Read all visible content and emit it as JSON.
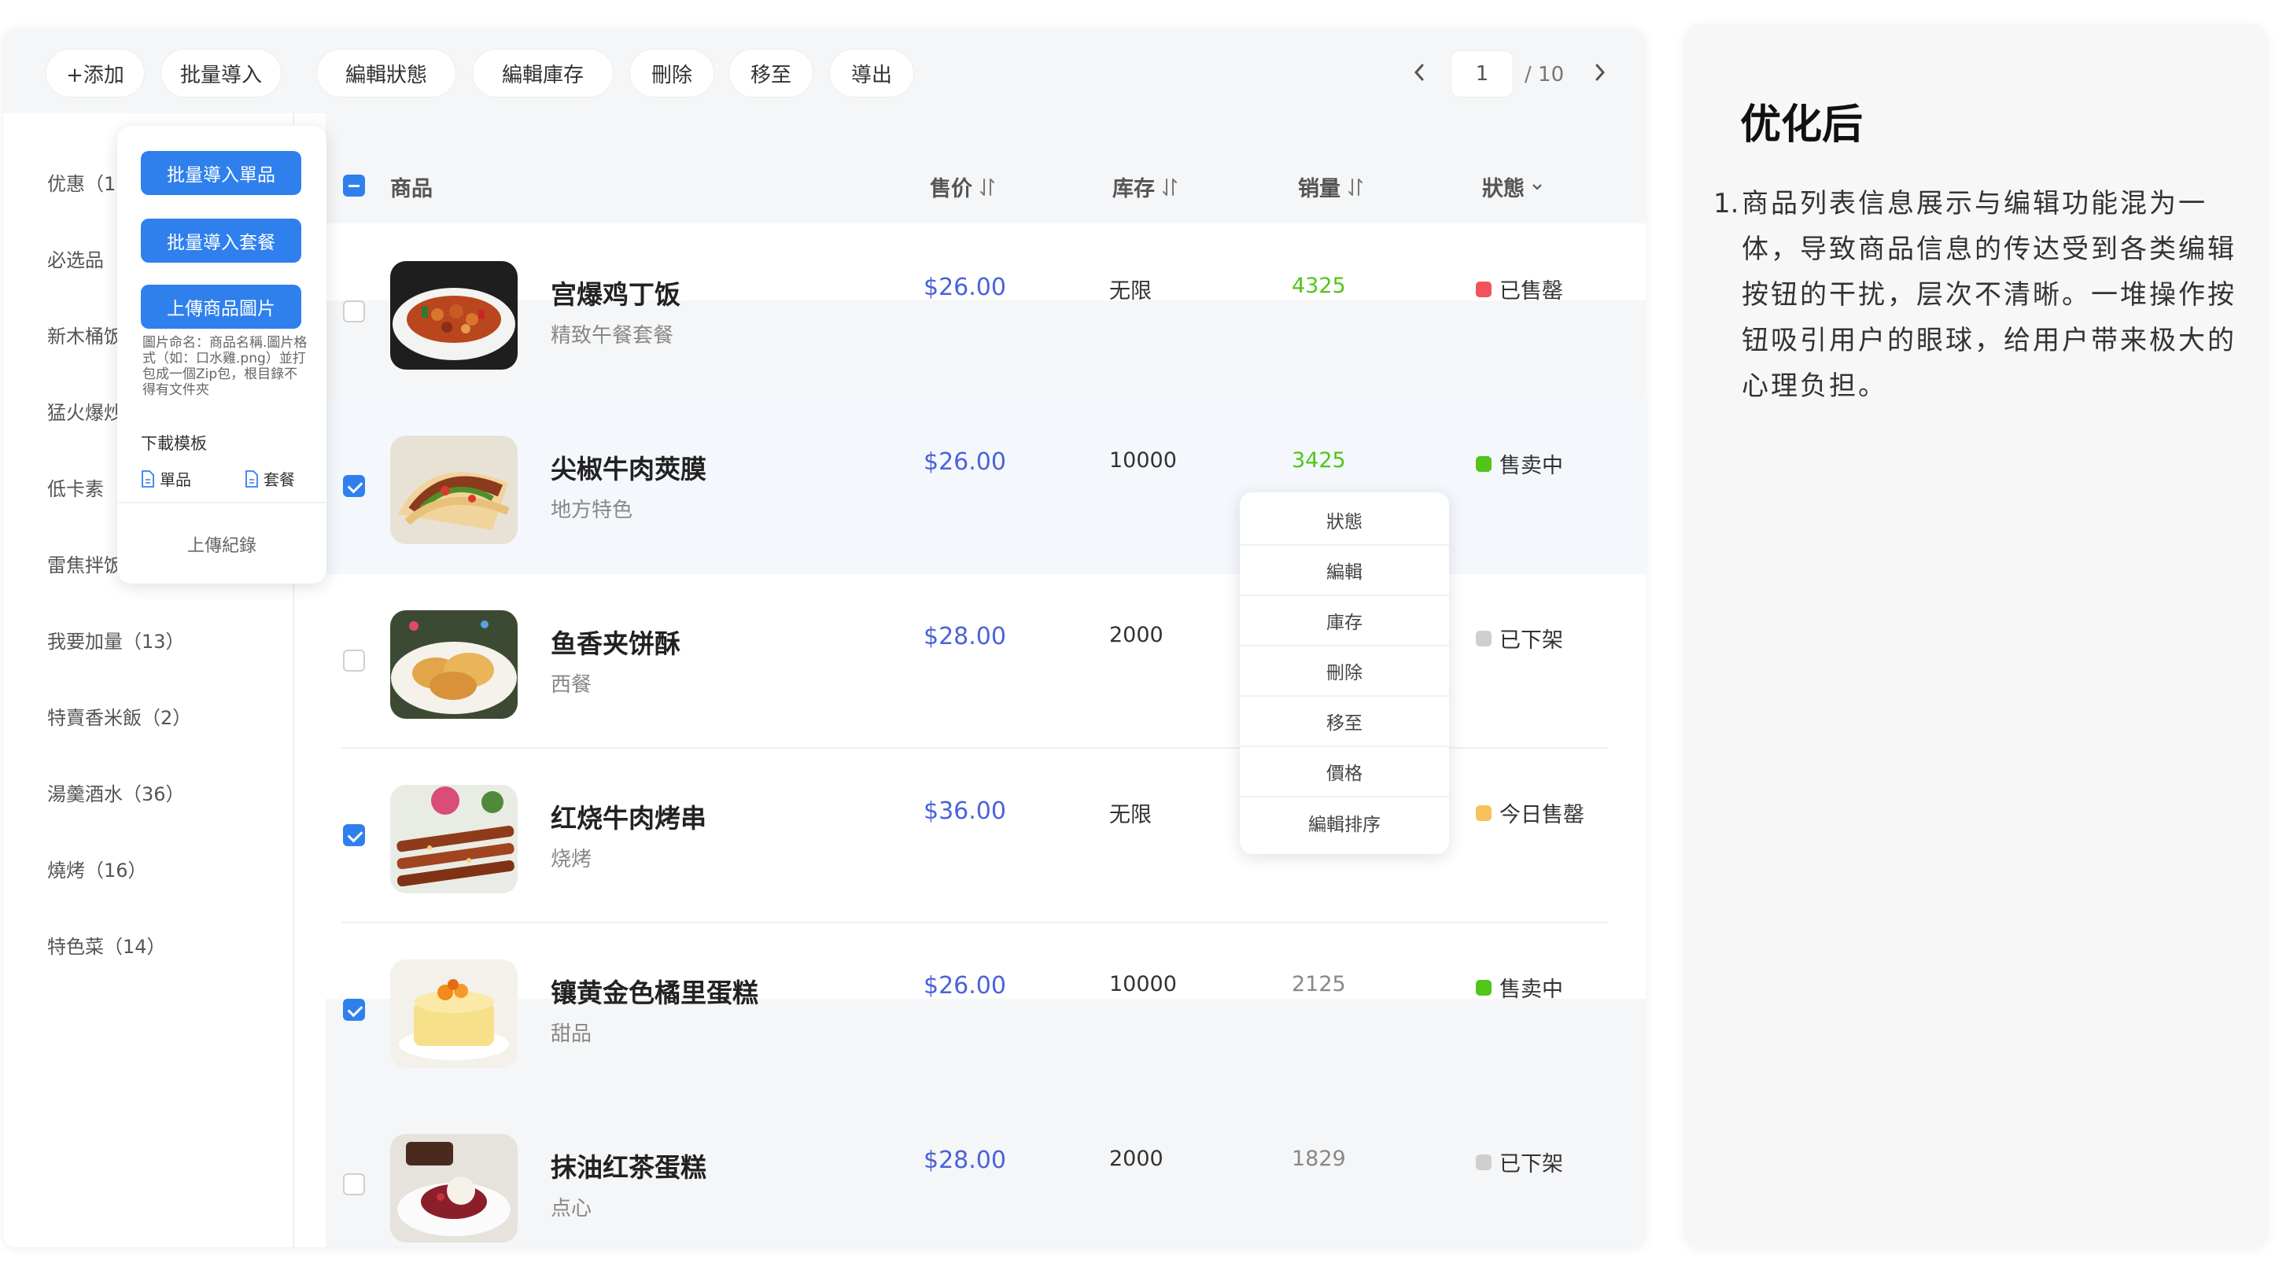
{
  "toolbar": {
    "buttons": [
      "+添加",
      "批量導入",
      "編輯狀態",
      "編輯庫存",
      "刪除",
      "移至",
      "導出"
    ],
    "page_current": "1",
    "page_total": "/ 10"
  },
  "import_menu": {
    "single": "批量導入單品",
    "combo": "批量導入套餐",
    "upload_image": "上傳商品圖片",
    "note": "圖片命名：商品名稱.圖片格式（如：口水雞.png）並打包成一個Zip包，根目錄不得有文件夾",
    "template_label": "下載模板",
    "file_single": "單品",
    "file_combo": "套餐",
    "upload_record": "上傳紀錄"
  },
  "sidebar": {
    "categories": [
      "优惠（1",
      "必选品",
      "新木桶饭",
      "猛火爆炒",
      "低卡素",
      "雷焦拌饭",
      "我要加量（13）",
      "特賣香米飯（2）",
      "湯羹酒水（36）",
      "燒烤（16）",
      "特色菜（14）"
    ]
  },
  "table": {
    "headers": {
      "product": "商品",
      "price": "售价",
      "stock": "库存",
      "sales": "销量",
      "status": "狀態"
    },
    "rows": [
      {
        "name": "宫爆鸡丁饭",
        "sub": "精致午餐套餐",
        "price": "$26.00",
        "stock": "无限",
        "sales": "4325",
        "status": "已售罄",
        "checked": false
      },
      {
        "name": "尖椒牛肉莢膜",
        "sub": "地方特色",
        "price": "$26.00",
        "stock": "10000",
        "sales": "3425",
        "status": "售卖中",
        "checked": true
      },
      {
        "name": "鱼香夹饼酥",
        "sub": "西餐",
        "price": "$28.00",
        "stock": "2000",
        "sales": "",
        "status": "已下架",
        "checked": false
      },
      {
        "name": "红烧牛肉烤串",
        "sub": "烧烤",
        "price": "$36.00",
        "stock": "无限",
        "sales": "",
        "status": "今日售罄",
        "checked": true
      },
      {
        "name": "镶黄金色橘里蛋糕",
        "sub": "甜品",
        "price": "$26.00",
        "stock": "10000",
        "sales": "2125",
        "status": "售卖中",
        "checked": true
      },
      {
        "name": "抹油红茶蛋糕",
        "sub": "点心",
        "price": "$28.00",
        "stock": "2000",
        "sales": "1829",
        "status": "已下架",
        "checked": false
      }
    ]
  },
  "action_menu": [
    "狀態",
    "編輯",
    "庫存",
    "刪除",
    "移至",
    "價格",
    "編輯排序"
  ],
  "note": {
    "title": "优化后",
    "item_num": "1.",
    "item_text": "商品列表信息展示与编辑功能混为一体，导致商品信息的传达受到各类编辑按钮的干扰，层次不清晰。一堆操作按钮吸引用户的眼球，给用户带来极大的心理负担。"
  },
  "colors": {
    "primary": "#2f80ed",
    "price": "#4a63d8",
    "sales_green": "#52c41a",
    "status_red": "#f0545a",
    "status_green": "#52c41a",
    "status_gray": "#cfcfcf",
    "status_yellow": "#f7c25c"
  }
}
